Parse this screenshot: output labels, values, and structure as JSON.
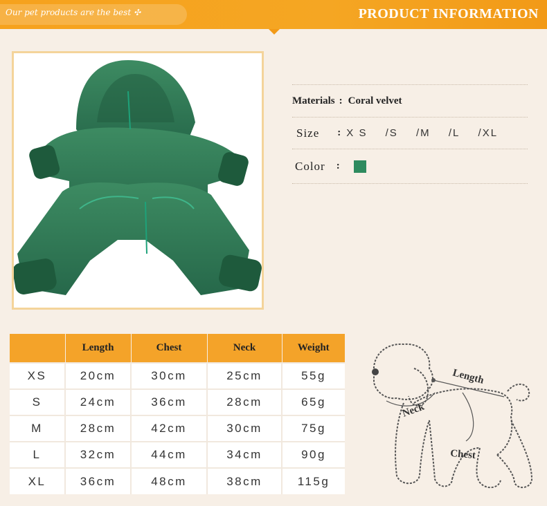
{
  "header": {
    "tagline": "Our pet products are the best ✣",
    "title": "PRODUCT INFORMATION"
  },
  "info": {
    "materials_label": "Materials",
    "materials_sep": ":",
    "materials_value": "Coral velvet",
    "size_label": "Size",
    "size_sep": ":",
    "sizes": [
      "X S",
      "/S",
      "/M",
      "/L",
      "/XL"
    ],
    "color_label": "Color",
    "color_sep": ":",
    "color_swatch": "#2e8b5f"
  },
  "table": {
    "headers": [
      "",
      "Length",
      "Chest",
      "Neck",
      "Weight"
    ],
    "rows": [
      [
        "XS",
        "20cm",
        "30cm",
        "25cm",
        "55g"
      ],
      [
        "S",
        "24cm",
        "36cm",
        "28cm",
        "65g"
      ],
      [
        "M",
        "28cm",
        "42cm",
        "30cm",
        "75g"
      ],
      [
        "L",
        "32cm",
        "44cm",
        "34cm",
        "90g"
      ],
      [
        "XL",
        "36cm",
        "48cm",
        "38cm",
        "115g"
      ]
    ]
  },
  "diagram": {
    "length_label": "Length",
    "neck_label": "Neck",
    "chest_label": "Chest"
  },
  "colors": {
    "header_orange": "#f5a623",
    "table_header": "#f4a329",
    "garment_green": "#2e7a52"
  }
}
